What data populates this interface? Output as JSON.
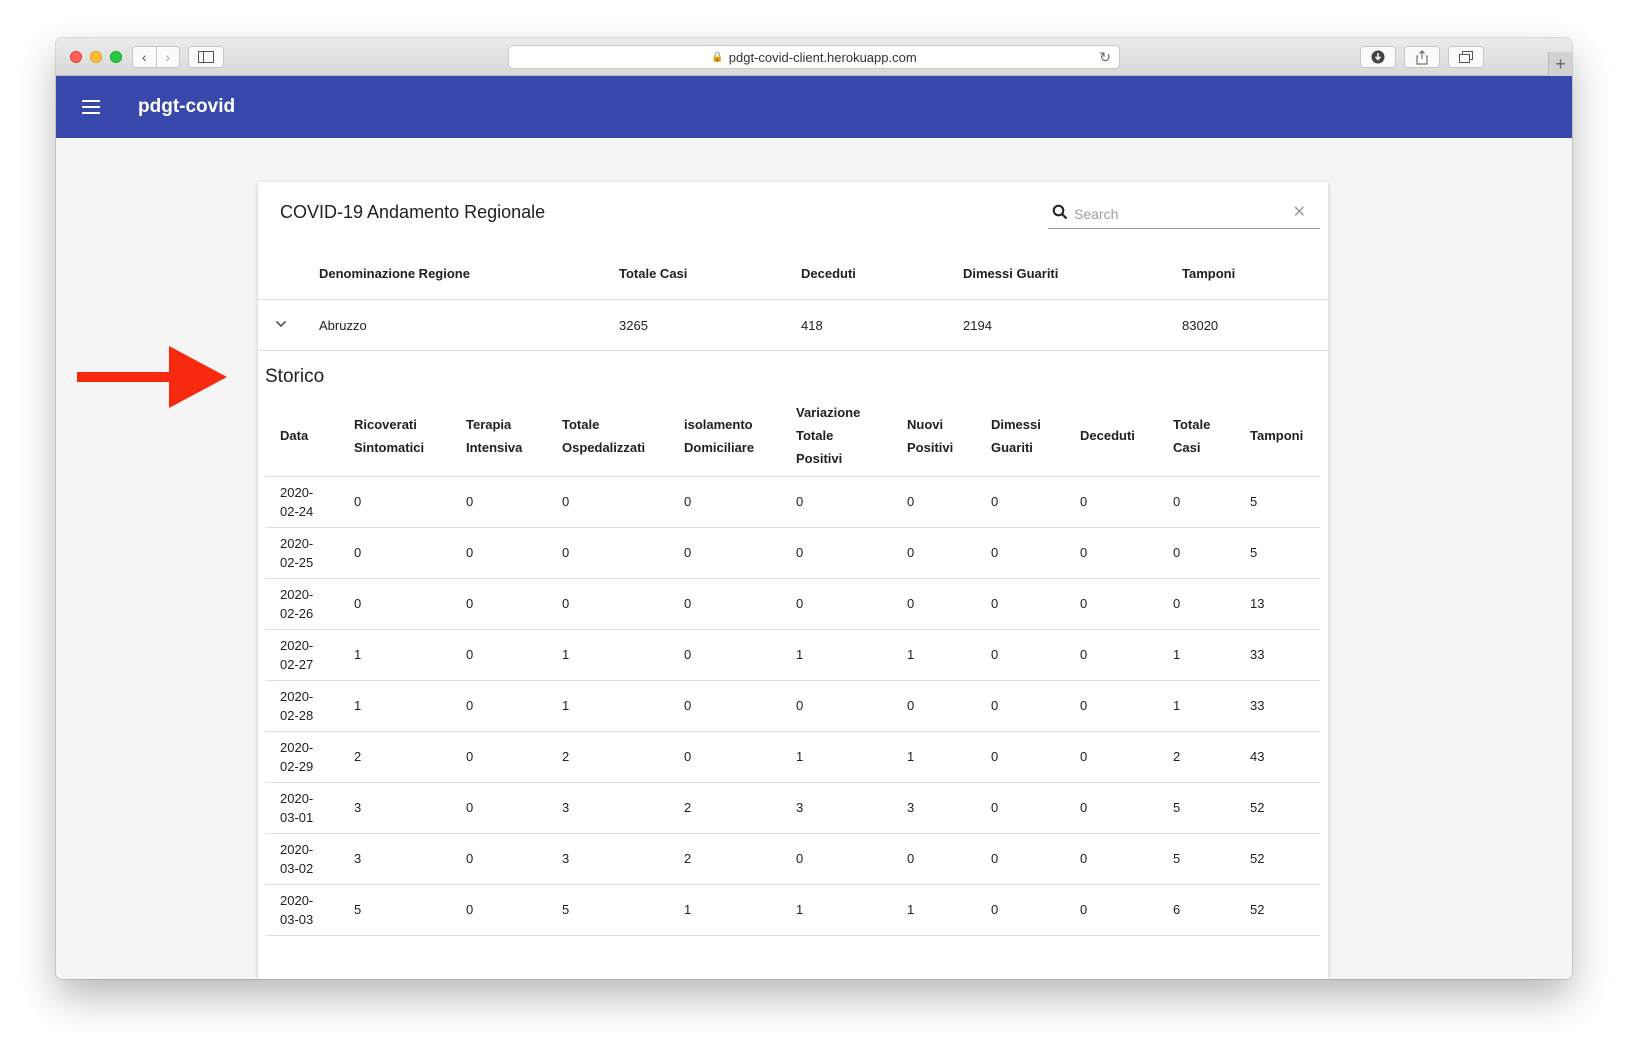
{
  "browser": {
    "url": "pdgt-covid-client.herokuapp.com"
  },
  "app": {
    "title": "pdgt-covid"
  },
  "card": {
    "title": "COVID-19 Andamento Regionale",
    "search_placeholder": "Search",
    "columns": [
      "Denominazione Regione",
      "Totale Casi",
      "Deceduti",
      "Dimessi Guariti",
      "Tamponi"
    ],
    "row": {
      "regione": "Abruzzo",
      "totale_casi": "3265",
      "deceduti": "418",
      "dimessi_guariti": "2194",
      "tamponi": "83020"
    }
  },
  "storico": {
    "title": "Storico",
    "columns": [
      [
        "Data"
      ],
      [
        "Ricoverati",
        "Sintomatici"
      ],
      [
        "Terapia",
        "Intensiva"
      ],
      [
        "Totale",
        "Ospedalizzati"
      ],
      [
        "isolamento",
        "Domiciliare"
      ],
      [
        "Variazione",
        "Totale",
        "Positivi"
      ],
      [
        "Nuovi",
        "Positivi"
      ],
      [
        "Dimessi",
        "Guariti"
      ],
      [
        "Deceduti"
      ],
      [
        "Totale",
        "Casi"
      ],
      [
        "Tamponi"
      ]
    ],
    "rows": [
      [
        "2020-02-24",
        "0",
        "0",
        "0",
        "0",
        "0",
        "0",
        "0",
        "0",
        "0",
        "5"
      ],
      [
        "2020-02-25",
        "0",
        "0",
        "0",
        "0",
        "0",
        "0",
        "0",
        "0",
        "0",
        "5"
      ],
      [
        "2020-02-26",
        "0",
        "0",
        "0",
        "0",
        "0",
        "0",
        "0",
        "0",
        "0",
        "13"
      ],
      [
        "2020-02-27",
        "1",
        "0",
        "1",
        "0",
        "1",
        "1",
        "0",
        "0",
        "1",
        "33"
      ],
      [
        "2020-02-28",
        "1",
        "0",
        "1",
        "0",
        "0",
        "0",
        "0",
        "0",
        "1",
        "33"
      ],
      [
        "2020-02-29",
        "2",
        "0",
        "2",
        "0",
        "1",
        "1",
        "0",
        "0",
        "2",
        "43"
      ],
      [
        "2020-03-01",
        "3",
        "0",
        "3",
        "2",
        "3",
        "3",
        "0",
        "0",
        "5",
        "52"
      ],
      [
        "2020-03-02",
        "3",
        "0",
        "3",
        "2",
        "0",
        "0",
        "0",
        "0",
        "5",
        "52"
      ],
      [
        "2020-03-03",
        "5",
        "0",
        "5",
        "1",
        "1",
        "1",
        "0",
        "0",
        "6",
        "52"
      ]
    ]
  },
  "colors": {
    "appbar": "#3848ab",
    "arrow": "#f7290f"
  }
}
